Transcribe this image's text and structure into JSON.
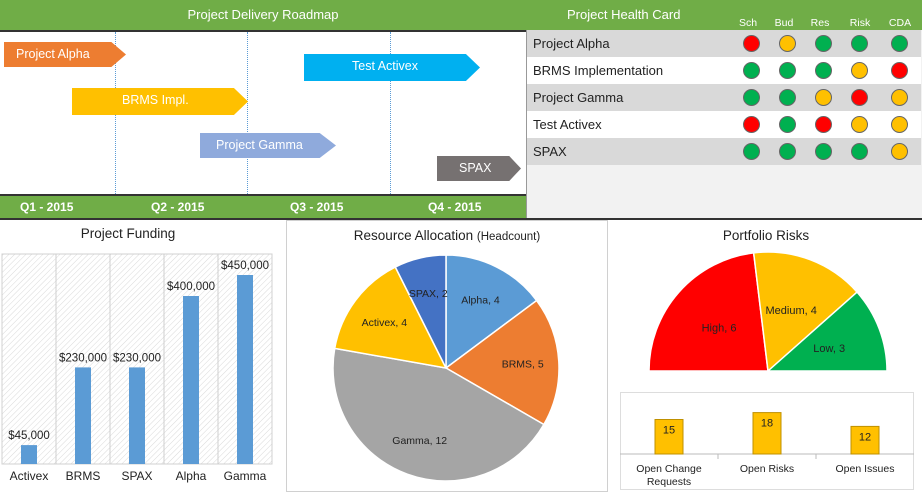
{
  "roadmap": {
    "title": "Project Delivery Roadmap",
    "quarters": [
      "Q1 - 2015",
      "Q2 - 2015",
      "Q3 - 2015",
      "Q4 - 2015"
    ],
    "items": [
      {
        "label": "Project Alpha",
        "color": "#ed7d31"
      },
      {
        "label": "BRMS Impl.",
        "color": "#ffc000"
      },
      {
        "label": "Project Gamma",
        "color": "#8faadc"
      },
      {
        "label": "Test Activex",
        "color": "#00b0f0"
      },
      {
        "label": "SPAX",
        "color": "#767171"
      }
    ]
  },
  "health": {
    "title": "Project Health Card",
    "columns": [
      "Sch",
      "Bud",
      "Res",
      "Risk",
      "CDA"
    ],
    "status_colors": {
      "red": "#ff0000",
      "amber": "#ffc000",
      "green": "#00b050"
    },
    "rows": [
      {
        "name": "Project Alpha",
        "status": [
          "red",
          "amber",
          "green",
          "green",
          "green"
        ]
      },
      {
        "name": "BRMS Implementation",
        "status": [
          "green",
          "green",
          "green",
          "amber",
          "red"
        ]
      },
      {
        "name": "Project Gamma",
        "status": [
          "green",
          "green",
          "amber",
          "red",
          "amber"
        ]
      },
      {
        "name": "Test Activex",
        "status": [
          "red",
          "green",
          "red",
          "amber",
          "amber"
        ]
      },
      {
        "name": "SPAX",
        "status": [
          "green",
          "green",
          "green",
          "green",
          "amber"
        ]
      }
    ]
  },
  "funding": {
    "title": "Project Funding"
  },
  "resource": {
    "title": "Resource Allocation",
    "subtitle": "(Headcount)"
  },
  "risks": {
    "title": "Portfolio Risks"
  },
  "chart_data": [
    {
      "type": "bar",
      "title": "Project Funding",
      "categories": [
        "Activex",
        "BRMS",
        "SPAX",
        "Alpha",
        "Gamma"
      ],
      "values": [
        45000,
        230000,
        230000,
        400000,
        450000
      ],
      "value_labels": [
        "$45,000",
        "$230,000",
        "$230,000",
        "$400,000",
        "$450,000"
      ],
      "ylim": [
        0,
        500000
      ],
      "color": "#5b9bd5"
    },
    {
      "type": "pie",
      "title": "Resource Allocation (Headcount)",
      "slices": [
        {
          "label": "Alpha, 4",
          "value": 4,
          "color": "#5b9bd5"
        },
        {
          "label": "BRMS, 5",
          "value": 5,
          "color": "#ed7d31"
        },
        {
          "label": "Gamma, 12",
          "value": 12,
          "color": "#a5a5a5"
        },
        {
          "label": "Activex, 4",
          "value": 4,
          "color": "#ffc000"
        },
        {
          "label": "SPAX, 2",
          "value": 2,
          "color": "#4472c4"
        }
      ]
    },
    {
      "type": "pie",
      "title": "Portfolio Risks",
      "semicircle": true,
      "slices": [
        {
          "label": "High, 6",
          "value": 6,
          "color": "#ff0000"
        },
        {
          "label": "Medium, 4",
          "value": 4,
          "color": "#ffc000"
        },
        {
          "label": "Low, 3",
          "value": 3,
          "color": "#00b050"
        }
      ]
    },
    {
      "type": "bar",
      "categories": [
        "Open Change Requests",
        "Open Risks",
        "Open Issues"
      ],
      "values": [
        15,
        18,
        12
      ],
      "ylim": [
        0,
        20
      ],
      "color": "#ffc000"
    }
  ]
}
